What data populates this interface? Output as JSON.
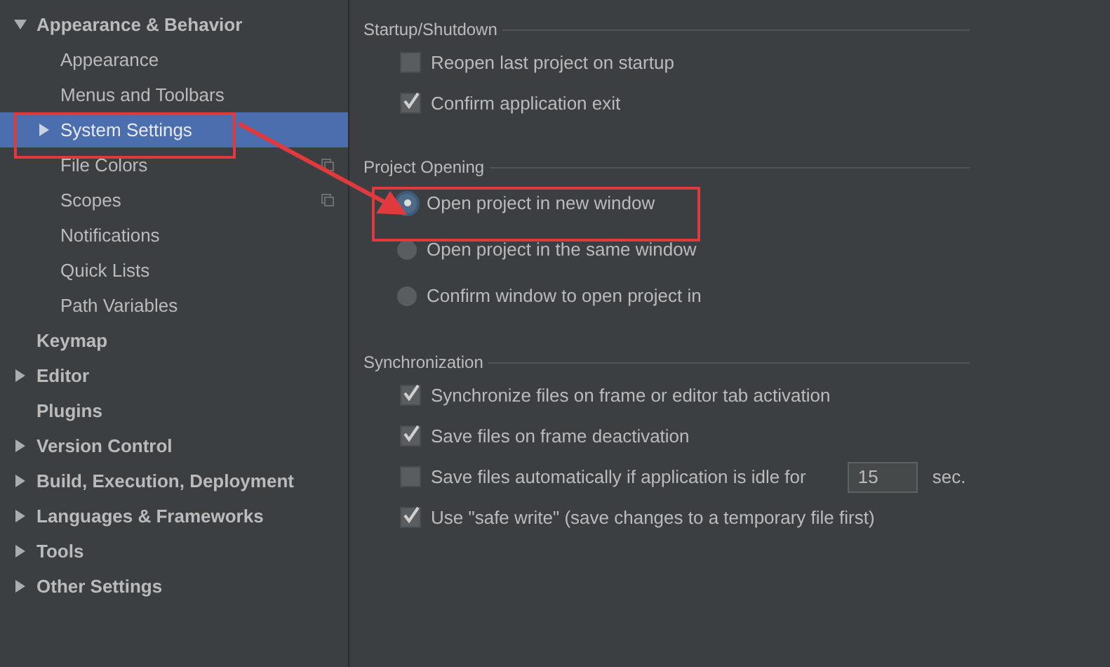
{
  "sidebar": {
    "items": [
      {
        "label": "Appearance & Behavior",
        "expanded": true,
        "selected": false,
        "children": [
          {
            "label": "Appearance",
            "selected": false
          },
          {
            "label": "Menus and Toolbars",
            "selected": false
          },
          {
            "label": "System Settings",
            "expanded": false,
            "selected": true
          },
          {
            "label": "File Colors",
            "selected": false,
            "project_icon": true
          },
          {
            "label": "Scopes",
            "selected": false,
            "project_icon": true
          },
          {
            "label": "Notifications",
            "selected": false
          },
          {
            "label": "Quick Lists",
            "selected": false
          },
          {
            "label": "Path Variables",
            "selected": false
          }
        ]
      },
      {
        "label": "Keymap",
        "selected": false
      },
      {
        "label": "Editor",
        "expanded": false,
        "selected": false
      },
      {
        "label": "Plugins",
        "selected": false
      },
      {
        "label": "Version Control",
        "expanded": false,
        "selected": false
      },
      {
        "label": "Build, Execution, Deployment",
        "expanded": false,
        "selected": false
      },
      {
        "label": "Languages & Frameworks",
        "expanded": false,
        "selected": false
      },
      {
        "label": "Tools",
        "expanded": false,
        "selected": false
      },
      {
        "label": "Other Settings",
        "expanded": false,
        "selected": false
      }
    ]
  },
  "sections": [
    {
      "title": "Startup/Shutdown",
      "items": [
        {
          "kind": "checkbox",
          "label": "Reopen last project on startup",
          "checked": false
        },
        {
          "kind": "checkbox",
          "label": "Confirm application exit",
          "checked": true
        }
      ]
    },
    {
      "title": "Project Opening",
      "items": [
        {
          "kind": "radio",
          "label": "Open project in new window",
          "selected": true
        },
        {
          "kind": "radio",
          "label": "Open project in the same window",
          "selected": false
        },
        {
          "kind": "radio",
          "label": "Confirm window to open project in",
          "selected": false
        }
      ]
    },
    {
      "title": "Synchronization",
      "items": [
        {
          "kind": "checkbox",
          "label": "Synchronize files on frame or editor tab activation",
          "checked": true
        },
        {
          "kind": "checkbox",
          "label": "Save files on frame deactivation",
          "checked": true
        },
        {
          "kind": "checkbox",
          "label": "Save files automatically if application is idle for",
          "checked": false,
          "value": "15",
          "unit": "sec."
        },
        {
          "kind": "checkbox",
          "label": "Use \"safe write\" (save changes to a temporary file first)",
          "checked": true
        }
      ]
    }
  ]
}
